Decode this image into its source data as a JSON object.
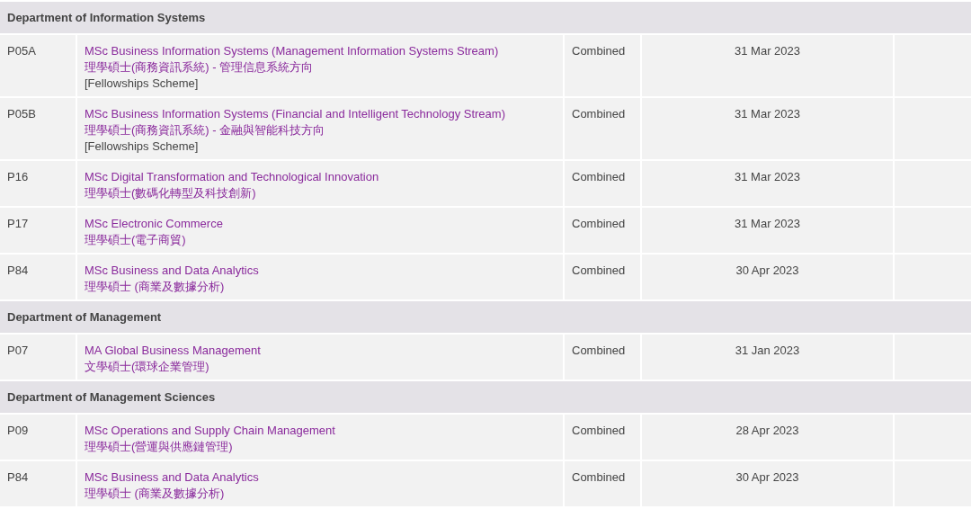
{
  "sections": [
    {
      "title": "Department of Information Systems",
      "programmes": [
        {
          "code": "P05A",
          "name_en": "MSc Business Information Systems (Management Information Systems Stream)",
          "name_zh": "理學碩士(商務資訊系統) - 管理信息系統方向",
          "note": "[Fellowships Scheme]",
          "mode": "Combined",
          "deadline": "31 Mar 2023"
        },
        {
          "code": "P05B",
          "name_en": "MSc Business Information Systems (Financial and Intelligent Technology Stream)",
          "name_zh": "理學碩士(商務資訊系統) - 金融與智能科技方向",
          "note": "[Fellowships Scheme]",
          "mode": "Combined",
          "deadline": "31 Mar 2023"
        },
        {
          "code": "P16",
          "name_en": "MSc Digital Transformation and Technological Innovation",
          "name_zh": "理學碩士(數碼化轉型及科技創新)",
          "mode": "Combined",
          "deadline": "31 Mar 2023"
        },
        {
          "code": "P17",
          "name_en": "MSc Electronic Commerce",
          "name_zh": "理學碩士(電子商貿)",
          "mode": "Combined",
          "deadline": "31 Mar 2023"
        },
        {
          "code": "P84",
          "name_en": "MSc Business and Data Analytics",
          "name_zh": "理學碩士 (商業及數據分析)",
          "mode": "Combined",
          "deadline": "30 Apr 2023"
        }
      ]
    },
    {
      "title": "Department of Management",
      "programmes": [
        {
          "code": "P07",
          "name_en": "MA Global Business Management",
          "name_zh": "文學碩士(環球企業管理)",
          "mode": "Combined",
          "deadline": "31 Jan 2023"
        }
      ]
    },
    {
      "title": "Department of Management Sciences",
      "programmes": [
        {
          "code": "P09",
          "name_en": "MSc Operations and Supply Chain Management",
          "name_zh": "理學碩士(營運與供應鏈管理)",
          "mode": "Combined",
          "deadline": "28 Apr 2023"
        },
        {
          "code": "P84",
          "name_en": "MSc Business and Data Analytics",
          "name_zh": "理學碩士 (商業及數據分析)",
          "mode": "Combined",
          "deadline": "30 Apr 2023"
        }
      ]
    }
  ]
}
